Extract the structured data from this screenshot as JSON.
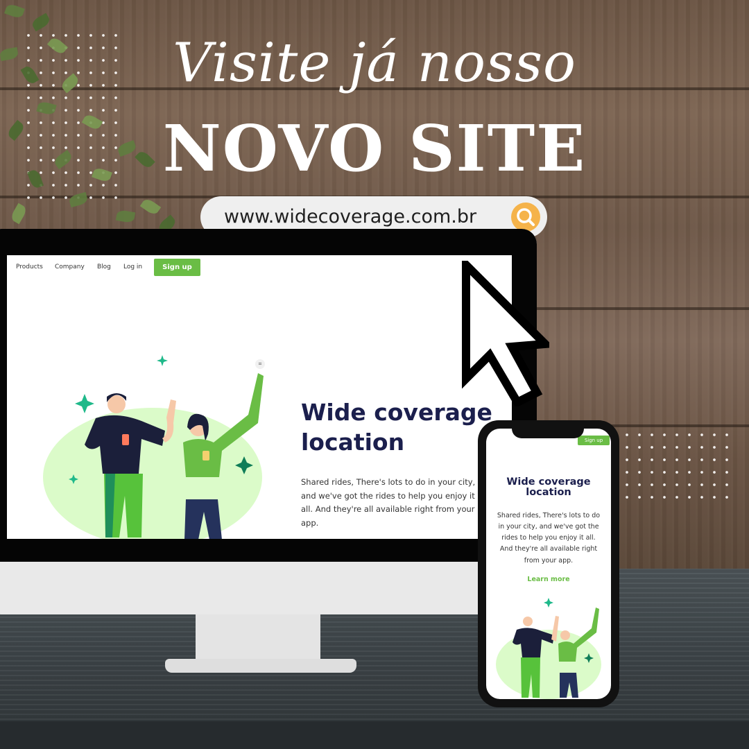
{
  "promo": {
    "script_title": "Visite já nosso",
    "main_title": "NOVO SITE",
    "url": "www.widecoverage.com.br"
  },
  "desktop_site": {
    "nav": {
      "products": "Products",
      "company": "Company",
      "blog": "Blog",
      "login": "Log in",
      "signup": "Sign up"
    },
    "hero_title_line1": "Wide coverage",
    "hero_title_line2": "location",
    "hero_desc": "Shared rides, There's lots to do in your city, and we've got the rides to help you enjoy it all. And they're all available right from your app."
  },
  "mobile_site": {
    "signup": "Sign up",
    "title_line1": "Wide coverage",
    "title_line2": "location",
    "desc": "Shared rides, There's lots to do in your city, and we've got the rides to help you enjoy it all. And they're all available right from your app.",
    "learn_more": "Learn more"
  },
  "colors": {
    "brand_green": "#6abd45",
    "navy": "#1b1f4d",
    "search_orange": "#f5b34a",
    "sparkle_green": "#1fb98a"
  },
  "icons": {
    "search": "search-icon",
    "cursor": "mouse-pointer-icon",
    "focus": "focus-icon"
  }
}
